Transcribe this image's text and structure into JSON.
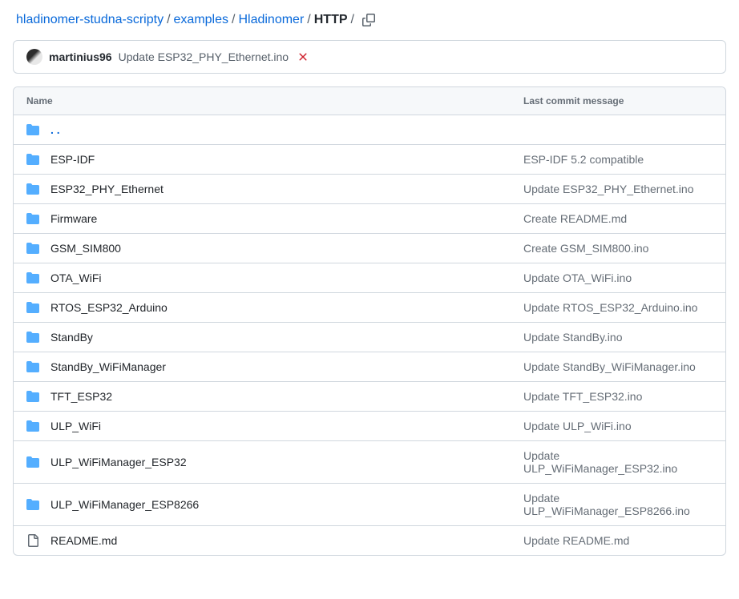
{
  "breadcrumb": {
    "parts": [
      {
        "label": "hladinomer-studna-scripty",
        "current": false
      },
      {
        "label": "examples",
        "current": false
      },
      {
        "label": "Hladinomer",
        "current": false
      },
      {
        "label": "HTTP",
        "current": true
      }
    ]
  },
  "commit_bar": {
    "author": "martinius96",
    "message": "Update ESP32_PHY_Ethernet.ino"
  },
  "table": {
    "headers": {
      "name": "Name",
      "commit": "Last commit message"
    },
    "parent_label": ". .",
    "rows": [
      {
        "type": "folder",
        "name": "ESP-IDF",
        "commit": "ESP-IDF 5.2 compatible"
      },
      {
        "type": "folder",
        "name": "ESP32_PHY_Ethernet",
        "commit": "Update ESP32_PHY_Ethernet.ino"
      },
      {
        "type": "folder",
        "name": "Firmware",
        "commit": "Create README.md"
      },
      {
        "type": "folder",
        "name": "GSM_SIM800",
        "commit": "Create GSM_SIM800.ino"
      },
      {
        "type": "folder",
        "name": "OTA_WiFi",
        "commit": "Update OTA_WiFi.ino"
      },
      {
        "type": "folder",
        "name": "RTOS_ESP32_Arduino",
        "commit": "Update RTOS_ESP32_Arduino.ino"
      },
      {
        "type": "folder",
        "name": "StandBy",
        "commit": "Update StandBy.ino"
      },
      {
        "type": "folder",
        "name": "StandBy_WiFiManager",
        "commit": "Update StandBy_WiFiManager.ino"
      },
      {
        "type": "folder",
        "name": "TFT_ESP32",
        "commit": "Update TFT_ESP32.ino"
      },
      {
        "type": "folder",
        "name": "ULP_WiFi",
        "commit": "Update ULP_WiFi.ino"
      },
      {
        "type": "folder",
        "name": "ULP_WiFiManager_ESP32",
        "commit": "Update ULP_WiFiManager_ESP32.ino"
      },
      {
        "type": "folder",
        "name": "ULP_WiFiManager_ESP8266",
        "commit": "Update ULP_WiFiManager_ESP8266.ino"
      },
      {
        "type": "file",
        "name": "README.md",
        "commit": "Update README.md"
      }
    ]
  }
}
